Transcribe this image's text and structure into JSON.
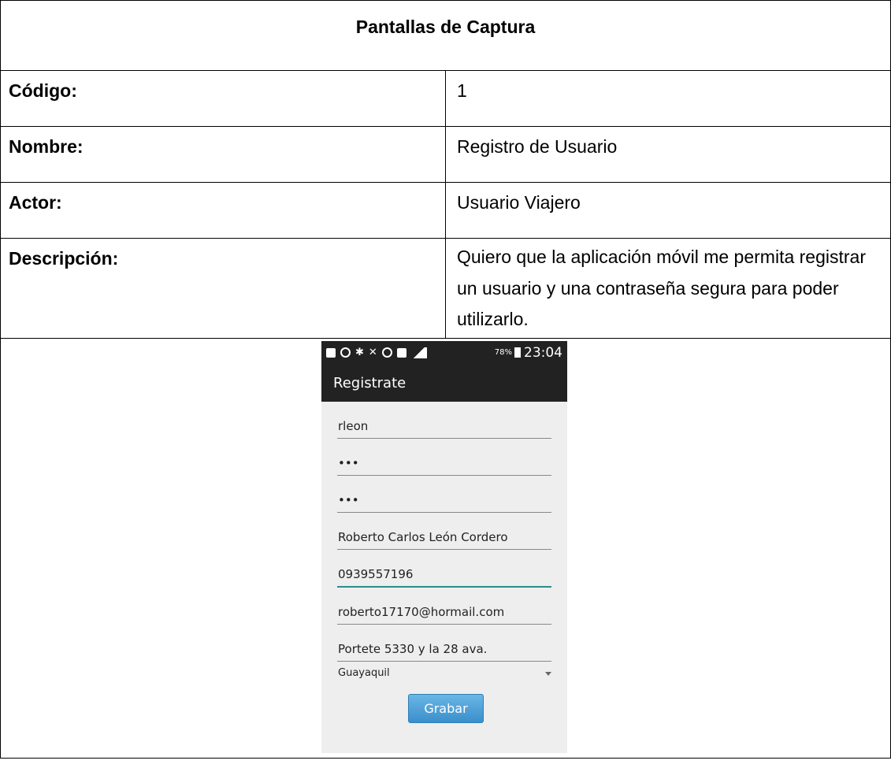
{
  "document": {
    "title": "Pantallas de Captura",
    "rows": [
      {
        "label": "Código:",
        "value": "1"
      },
      {
        "label": "Nombre:",
        "value": "Registro de Usuario"
      },
      {
        "label": "Actor:",
        "value": "Usuario Viajero"
      },
      {
        "label": "Descripción:",
        "value": "Quiero que la aplicación móvil me permita registrar un usuario y una contraseña segura para poder utilizarlo."
      }
    ]
  },
  "phone": {
    "status_bar": {
      "battery": "78%",
      "time": "23:04"
    },
    "app_title": "Registrate",
    "fields": [
      {
        "value": "rleon"
      },
      {
        "value": "•••"
      },
      {
        "value": "•••"
      },
      {
        "value": "Roberto Carlos León Cordero"
      },
      {
        "value": "0939557196"
      },
      {
        "value": "roberto17170@hormail.com"
      },
      {
        "value": "Portete 5330 y la 28 ava."
      }
    ],
    "city_select": "Guayaquil",
    "save_button": "Grabar"
  },
  "colors": {
    "status_bar_bg": "#222222",
    "screen_bg": "#eeeeee",
    "focus_underline": "#2a8f8a",
    "button_blue": "#3a8fcb"
  }
}
